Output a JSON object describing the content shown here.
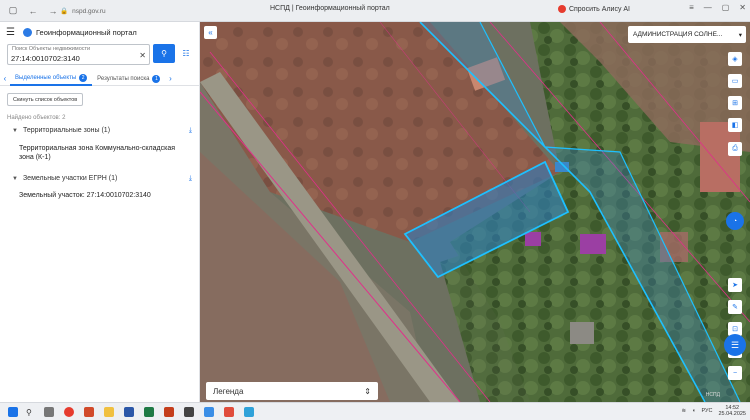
{
  "browser": {
    "url": "nspd.gov.ru",
    "tab_title": "НСПД | Геоинформационный портал",
    "assistant_label": "Спросить Алису AI"
  },
  "panel": {
    "title": "Геоинформационный портал",
    "search": {
      "label": "Поиск Объекты недвижимости",
      "value": "27:14:0010702:3140"
    },
    "tabs": [
      {
        "label": "Выделенные объекты",
        "badge": "2",
        "active": true
      },
      {
        "label": "Результаты поиска",
        "badge": "1",
        "active": false
      }
    ],
    "reset_label": "Скинуть список объектов",
    "found_label": "Найдено объектов: 2",
    "groups": [
      {
        "title": "Территориальные зоны (1)",
        "item": "Территориальная зона Коммунально-складская зона (К-1)"
      },
      {
        "title": "Земельные участки ЕГРН (1)",
        "item": "Земельный участок: 27:14:0010702:3140"
      }
    ]
  },
  "map": {
    "layer_select": "АДМИНИСТРАЦИЯ СОЛНЕ...",
    "legend_label": "Легенда",
    "scale_label": "НСПД",
    "tools": [
      "layers-icon",
      "ruler-icon",
      "search-area-icon",
      "print-icon",
      "chat-icon",
      "locate-icon",
      "draw-icon",
      "zoom-fit-icon",
      "zoom-in-icon",
      "zoom-out-icon"
    ]
  },
  "taskbar": {
    "lang": "РУС",
    "time": "14:52",
    "date": "25.04.2025"
  },
  "colors": {
    "accent": "#1a73e8",
    "parcel_fill": "#2f7fbf",
    "parcel_stroke": "#1ec0ff",
    "zone_line": "#e0308a"
  }
}
